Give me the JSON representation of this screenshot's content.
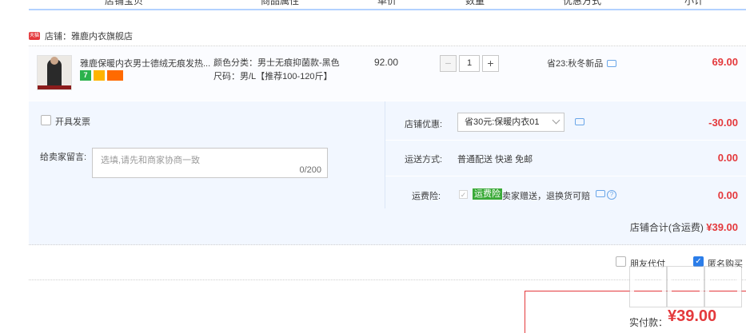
{
  "header": {
    "cols": [
      "店铺宝贝",
      "商品属性",
      "单价",
      "数量",
      "优惠方式",
      "小计"
    ]
  },
  "shop": {
    "badge": "天猫",
    "name": "店铺：雅鹿内衣旗舰店"
  },
  "item": {
    "title": "雅鹿保暖内衣男士德绒无痕发热...",
    "badges": [
      "7",
      "",
      ""
    ],
    "attr_color": "颜色分类：男士无痕抑菌款-黑色",
    "attr_size": "尺码：男/L【推荐100-120斤】",
    "price": "92.00",
    "qty_minus": "−",
    "qty": "1",
    "qty_plus": "+",
    "promo": "省23:秋冬新品",
    "subtotal": "69.00"
  },
  "options": {
    "invoice_label": "开具发票",
    "message_label": "给卖家留言:",
    "message_placeholder": "选填,请先和商家协商一致",
    "message_counter": "0/200",
    "shop_coupon_label": "店铺优惠:",
    "shop_coupon_value": "省30元:保暖内衣01",
    "shop_coupon_amount": "-30.00",
    "shipping_label": "运送方式:",
    "shipping_value": "普通配送 快递 免邮",
    "shipping_amount": "0.00",
    "insurance_label": "运费险:",
    "insurance_check": "✓",
    "insurance_tag": "运费险",
    "insurance_text": "卖家赠送，退换货可赔",
    "insurance_amount": "0.00",
    "shop_total_label": "店铺合计(含运费)",
    "shop_total_value": "¥39.00"
  },
  "footer": {
    "friend_pay": "朋友代付",
    "anonymous": "匿名购买",
    "anonymous_check": "✓",
    "pay_label": "实付款：",
    "pay_amount": "¥39.00"
  },
  "colors": {
    "accent": "#e4393c",
    "link": "#2b7de9",
    "panel": "#f2f7ff"
  }
}
